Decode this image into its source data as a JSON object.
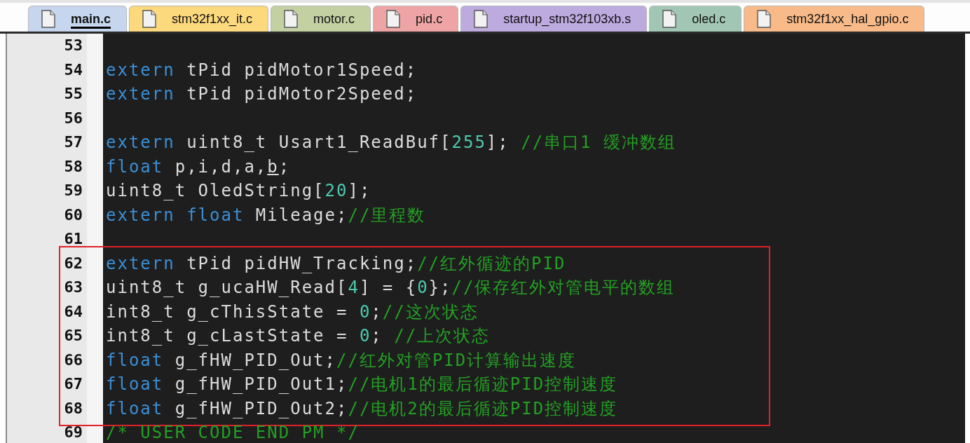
{
  "tabs": [
    {
      "label": "main.c",
      "color": "#c6d6ef",
      "selected": true
    },
    {
      "label": "stm32f1xx_it.c",
      "color": "#fcd97c",
      "selected": false
    },
    {
      "label": "motor.c",
      "color": "#c3d0a2",
      "selected": false
    },
    {
      "label": "pid.c",
      "color": "#eea4a4",
      "selected": false
    },
    {
      "label": "startup_stm32f103xb.s",
      "color": "#bdaadf",
      "selected": false
    },
    {
      "label": "oled.c",
      "color": "#a2c6b4",
      "selected": false
    },
    {
      "label": "stm32f1xx_hal_gpio.c",
      "color": "#f7ba88",
      "selected": false
    }
  ],
  "blocks": [
    {
      "highlighted": false,
      "lines": [
        {
          "number": "53"
        },
        {
          "number": "54",
          "tokens": [
            {
              "kind": "keyword",
              "text": "extern"
            },
            {
              "kind": "plain",
              "text": " tPid pidMotor1Speed;"
            }
          ]
        },
        {
          "number": "55",
          "tokens": [
            {
              "kind": "keyword",
              "text": "extern"
            },
            {
              "kind": "plain",
              "text": " tPid pidMotor2Speed;"
            }
          ]
        },
        {
          "number": "56"
        },
        {
          "number": "57",
          "tokens": [
            {
              "kind": "keyword",
              "text": "extern"
            },
            {
              "kind": "plain",
              "text": " uint8_t Usart1_ReadBuf["
            },
            {
              "kind": "number",
              "text": "255"
            },
            {
              "kind": "plain",
              "text": "]; "
            },
            {
              "kind": "comment",
              "text": "//串口1 缓冲数组"
            }
          ]
        },
        {
          "number": "58",
          "tokens": [
            {
              "kind": "keyword",
              "text": "float"
            },
            {
              "kind": "plain",
              "text": " p,i,d,a,"
            },
            {
              "kind": "underlined",
              "text": "b"
            },
            {
              "kind": "plain",
              "text": ";"
            }
          ]
        },
        {
          "number": "59",
          "tokens": [
            {
              "kind": "plain",
              "text": "uint8_t OledString["
            },
            {
              "kind": "number",
              "text": "20"
            },
            {
              "kind": "plain",
              "text": "];"
            }
          ]
        },
        {
          "number": "60",
          "tokens": [
            {
              "kind": "keyword",
              "text": "extern float"
            },
            {
              "kind": "plain",
              "text": " Mileage;"
            },
            {
              "kind": "comment",
              "text": "//里程数"
            }
          ]
        },
        {
          "number": "61"
        }
      ]
    },
    {
      "highlighted": true,
      "lines": [
        {
          "number": "62",
          "tokens": [
            {
              "kind": "keyword",
              "text": "extern"
            },
            {
              "kind": "plain",
              "text": " tPid pidHW_Tracking;"
            },
            {
              "kind": "comment",
              "text": "//红外循迹的PID"
            }
          ]
        },
        {
          "number": "63",
          "tokens": [
            {
              "kind": "plain",
              "text": "uint8_t g_ucaHW_Read["
            },
            {
              "kind": "number",
              "text": "4"
            },
            {
              "kind": "plain",
              "text": "] = {"
            },
            {
              "kind": "number",
              "text": "0"
            },
            {
              "kind": "plain",
              "text": "};"
            },
            {
              "kind": "comment",
              "text": "//保存红外对管电平的数组"
            }
          ]
        },
        {
          "number": "64",
          "tokens": [
            {
              "kind": "plain",
              "text": "int8_t g_cThisState = "
            },
            {
              "kind": "number",
              "text": "0"
            },
            {
              "kind": "plain",
              "text": ";"
            },
            {
              "kind": "comment",
              "text": "//这次状态"
            }
          ]
        },
        {
          "number": "65",
          "tokens": [
            {
              "kind": "plain",
              "text": "int8_t g_cLastState = "
            },
            {
              "kind": "number",
              "text": "0"
            },
            {
              "kind": "plain",
              "text": "; "
            },
            {
              "kind": "comment",
              "text": "//上次状态"
            }
          ]
        },
        {
          "number": "66",
          "tokens": [
            {
              "kind": "keyword",
              "text": "float"
            },
            {
              "kind": "plain",
              "text": " g_fHW_PID_Out;"
            },
            {
              "kind": "comment",
              "text": "//红外对管PID计算输出速度"
            }
          ]
        },
        {
          "number": "67",
          "tokens": [
            {
              "kind": "keyword",
              "text": "float"
            },
            {
              "kind": "plain",
              "text": " g_fHW_PID_Out1;"
            },
            {
              "kind": "comment",
              "text": "//电机1的最后循迹PID控制速度"
            }
          ]
        },
        {
          "number": "68",
          "tokens": [
            {
              "kind": "keyword",
              "text": "float"
            },
            {
              "kind": "plain",
              "text": " g_fHW_PID_Out2;"
            },
            {
              "kind": "comment",
              "text": "//电机2的最后循迹PID控制速度"
            }
          ]
        }
      ]
    },
    {
      "highlighted": false,
      "lines": [
        {
          "number": "69",
          "tokens": [
            {
              "kind": "comment",
              "text": "/* USER CODE END PM */"
            }
          ]
        }
      ]
    }
  ]
}
